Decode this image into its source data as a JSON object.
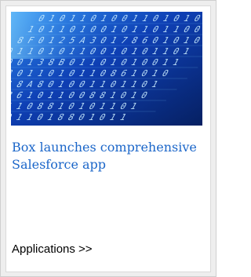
{
  "card": {
    "image": {
      "description_icon": "binary-data-photo",
      "colors": {
        "base": "#0a2b8f",
        "highlight": "#49b7ff",
        "glyph": "#c9ecff"
      }
    },
    "headline": "Box launches comprehensive Salesforce app",
    "category_link": "Applications >>",
    "colors": {
      "headline": "#1b66c9",
      "category": "#000000",
      "border": "#cfcfcf"
    }
  }
}
